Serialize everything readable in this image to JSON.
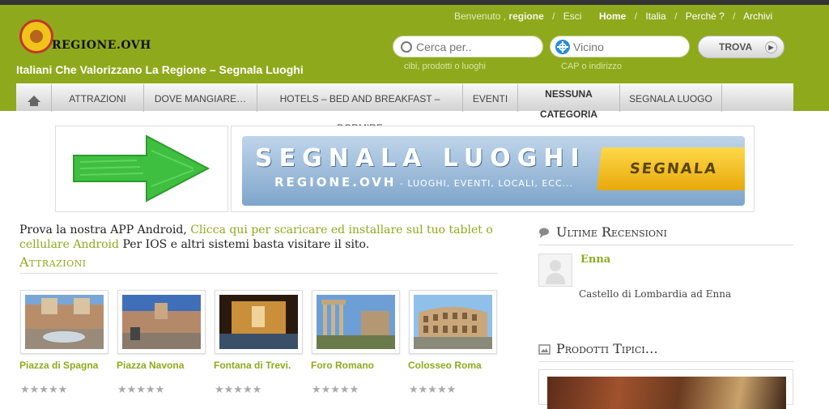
{
  "site": {
    "logo_text": "REGIONE.OVH",
    "tagline": "Italiani Che Valorizzano La Regione – Segnala Luoghi"
  },
  "userbar": {
    "welcome": "Benvenuto ,",
    "user": "regione",
    "slash": "/",
    "logout": "Esci"
  },
  "topnav": {
    "home": "Home",
    "italia": "Italia",
    "perche": "Perchè ?",
    "archivi": "Archivi",
    "sep": "/"
  },
  "search": {
    "what_placeholder": "Cerca per..",
    "what_hint": "cibi, prodotti o luoghi",
    "where_placeholder": "Vicino",
    "where_hint": "CAP o indirizzo",
    "button": "TROVA",
    "button_arrow": "▶"
  },
  "menu": {
    "items": [
      "ATTRAZIONI",
      "DOVE MANGIARE…",
      "HOTELS – BED AND BREAKFAST – DORMIRE",
      "EVENTI",
      "NESSUNA CATEGORIA",
      "SEGNALA LUOGO"
    ]
  },
  "banner": {
    "headline": "SEGNALA LUOGHI",
    "site": "REGIONE.OVH",
    "subline": " - LUOGHI, EVENTI, LOCALI, ECC...",
    "button": "SEGNALA"
  },
  "intro": {
    "before": "Prova la nostra APP Android, ",
    "link": "Clicca qui per scaricare ed installare sul tuo tablet o cellulare Android",
    "after": " Per IOS e altri sistemi basta visitare il sito."
  },
  "attractions": {
    "title": "Attrazioni",
    "items": [
      {
        "name": "Piazza di Spagna"
      },
      {
        "name": "Piazza Navona"
      },
      {
        "name": "Fontana di Trevi."
      },
      {
        "name": "Foro Romano"
      },
      {
        "name": "Colosseo Roma"
      }
    ],
    "stars": "★★★★★"
  },
  "sidebar": {
    "reviews_title": "Ultime Recensioni",
    "review": {
      "name": "Enna",
      "text": "Castello di Lombardia ad Enna"
    },
    "products_title": "Prodotti Tipici…"
  },
  "colors": {
    "brand_green": "#8fa91c",
    "arrow_green": "#3fbf3f"
  }
}
